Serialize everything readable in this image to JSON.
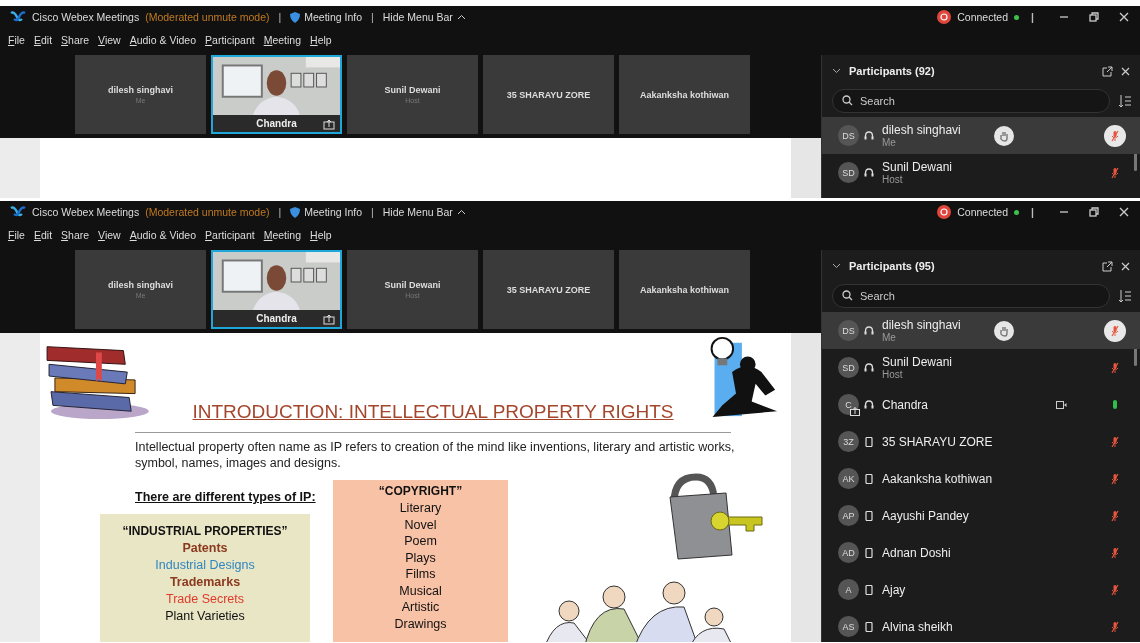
{
  "windows": [
    {
      "title_bar": {
        "app": "Cisco Webex Meetings",
        "mode": "(Moderated unmute mode)",
        "separator_1": "|",
        "meeting_info": "Meeting Info",
        "separator_2": "|",
        "hide_menu": "Hide Menu Bar",
        "status": "Connected",
        "separator_3": "|"
      },
      "menu": [
        "File",
        "Edit",
        "Share",
        "View",
        "Audio & Video",
        "Participant",
        "Meeting",
        "Help"
      ],
      "tiles": [
        {
          "kind": "name",
          "name": "dilesh singhavi",
          "role": "Me",
          "selected": false
        },
        {
          "kind": "video",
          "name": "Chandra",
          "selected": true,
          "sharing": true
        },
        {
          "kind": "name",
          "name": "Sunil Dewani",
          "role": "Host",
          "selected": false
        },
        {
          "kind": "name",
          "name": "35 SHARAYU ZORE",
          "selected": false
        },
        {
          "kind": "name",
          "name": "Aakanksha kothiwan",
          "selected": false
        }
      ],
      "participants": {
        "title": "Participants (92)",
        "search_placeholder": "Search",
        "rows": [
          {
            "initials": "DS",
            "kind": "headset",
            "name": "dilesh singhavi",
            "role": "Me",
            "selected": true,
            "hand_raised": true,
            "muted": true
          },
          {
            "initials": "SD",
            "kind": "headset",
            "name": "Sunil Dewani",
            "role": "Host",
            "selected": false,
            "hand_raised": false,
            "muted": true
          }
        ]
      }
    },
    {
      "title_bar": {
        "app": "Cisco Webex Meetings",
        "mode": "(Moderated unmute mode)",
        "separator_1": "|",
        "meeting_info": "Meeting Info",
        "separator_2": "|",
        "hide_menu": "Hide Menu Bar",
        "status": "Connected",
        "separator_3": "|"
      },
      "menu": [
        "File",
        "Edit",
        "Share",
        "View",
        "Audio & Video",
        "Participant",
        "Meeting",
        "Help"
      ],
      "tiles": [
        {
          "kind": "name",
          "name": "dilesh singhavi",
          "role": "Me",
          "selected": false
        },
        {
          "kind": "video",
          "name": "Chandra",
          "selected": true,
          "sharing": true
        },
        {
          "kind": "name",
          "name": "Sunil Dewani",
          "role": "Host",
          "selected": false
        },
        {
          "kind": "name",
          "name": "35 SHARAYU ZORE",
          "selected": false
        },
        {
          "kind": "name",
          "name": "Aakanksha kothiwan",
          "selected": false
        }
      ],
      "participants": {
        "title": "Participants (95)",
        "search_placeholder": "Search",
        "rows": [
          {
            "initials": "DS",
            "kind": "headset",
            "name": "dilesh singhavi",
            "role": "Me",
            "selected": true,
            "hand_raised": true,
            "muted": true
          },
          {
            "initials": "SD",
            "kind": "headset",
            "name": "Sunil Dewani",
            "role": "Host",
            "selected": false,
            "hand_raised": false,
            "muted": true
          },
          {
            "initials": "C",
            "kind": "headset",
            "name": "Chandra",
            "selected": false,
            "hand_raised": false,
            "muted": false,
            "sharing": true,
            "video": true
          },
          {
            "initials": "3Z",
            "kind": "phone",
            "name": "35 SHARAYU ZORE",
            "selected": false,
            "hand_raised": false,
            "muted": true
          },
          {
            "initials": "AK",
            "kind": "phone",
            "name": "Aakanksha kothiwan",
            "selected": false,
            "hand_raised": false,
            "muted": true
          },
          {
            "initials": "AP",
            "kind": "phone",
            "name": "Aayushi Pandey",
            "selected": false,
            "hand_raised": false,
            "muted": true
          },
          {
            "initials": "AD",
            "kind": "phone",
            "name": "Adnan Doshi",
            "selected": false,
            "hand_raised": false,
            "muted": true
          },
          {
            "initials": "A",
            "kind": "phone",
            "name": "Ajay",
            "selected": false,
            "hand_raised": false,
            "muted": true
          },
          {
            "initials": "AS",
            "kind": "phone",
            "name": "Alvina sheikh",
            "selected": false,
            "hand_raised": false,
            "muted": true
          }
        ]
      },
      "slide": {
        "title": "INTRODUCTION: INTELLECTUAL PROPERTY RIGHTS",
        "paragraph": "Intellectual property often name as IP refers to creation of the mind like inventions, literary and artistic works, symbol, names, images and designs.",
        "types_heading": "There are different types of IP:",
        "industrial": {
          "heading": "“INDUSTRIAL PROPERTIES”",
          "items": [
            {
              "text": "Patents",
              "color": "#8b3a1e",
              "bold": true
            },
            {
              "text": "Industrial Designs",
              "color": "#2e86c1",
              "bold": false
            },
            {
              "text": "Trademarks",
              "color": "#8b3a1e",
              "bold": true
            },
            {
              "text": "Trade Secrets",
              "color": "#e03a2a",
              "bold": false
            },
            {
              "text": "Plant Varieties",
              "color": "#111111",
              "bold": false
            }
          ]
        },
        "copyright": {
          "heading": "“COPYRIGHT”",
          "items": [
            "Literary",
            "Novel",
            "Poem",
            "Plays",
            "Films",
            "Musical",
            "Artistic",
            "Drawings"
          ]
        }
      }
    }
  ]
}
